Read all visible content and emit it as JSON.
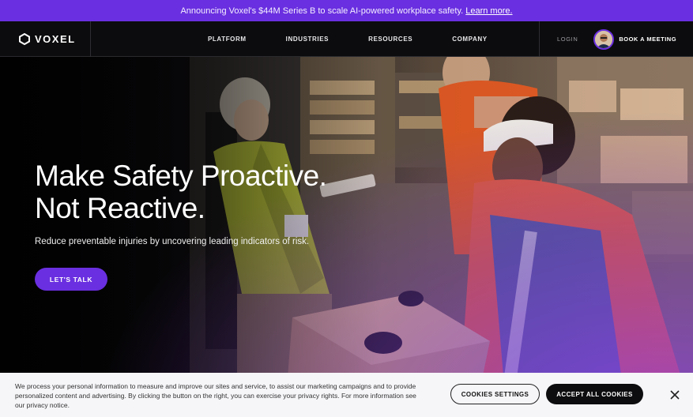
{
  "announcement": {
    "text": "Announcing Voxel's $44M Series B to scale AI-powered workplace safety.",
    "link": "Learn more."
  },
  "nav": {
    "brand": "VOXEL",
    "items": [
      "PLATFORM",
      "INDUSTRIES",
      "RESOURCES",
      "COMPANY"
    ],
    "login": "LOGIN",
    "book": "BOOK A MEETING"
  },
  "hero": {
    "title_line1": "Make Safety Proactive.",
    "title_line2": "Not Reactive.",
    "subtitle": "Reduce preventable injuries by uncovering leading indicators of risk.",
    "cta": "LET'S TALK"
  },
  "cookie": {
    "text": "We process your personal information to measure and improve our sites and service, to assist our marketing campaigns and to provide personalized content and advertising. By clicking the button on the right, you can exercise your privacy rights. For more information see our privacy notice.",
    "settings": "COOKIES SETTINGS",
    "accept": "ACCEPT ALL COOKIES"
  },
  "colors": {
    "brand_purple": "#6a2fe0",
    "nav_bg": "#0c0c0e",
    "cookie_bg": "#f6f5f8"
  }
}
